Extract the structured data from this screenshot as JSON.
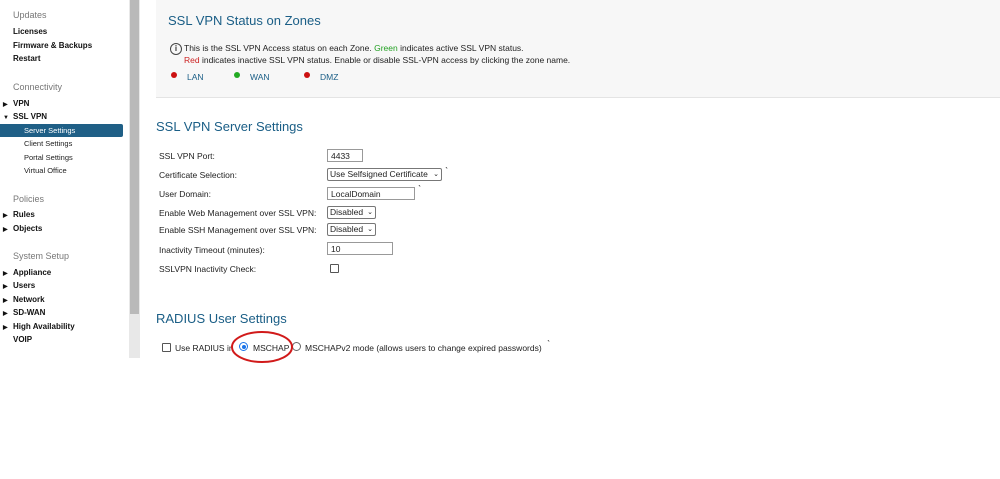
{
  "sidebar": {
    "updates_header": "Updates",
    "licenses": "Licenses",
    "firmware": "Firmware & Backups",
    "restart": "Restart",
    "connectivity_header": "Connectivity",
    "vpn": "VPN",
    "sslvpn": "SSL VPN",
    "sslvpn_items": [
      "Server Settings",
      "Client Settings",
      "Portal Settings",
      "Virtual Office"
    ],
    "policies_header": "Policies",
    "rules": "Rules",
    "objects": "Objects",
    "system_header": "System Setup",
    "system_items": [
      "Appliance",
      "Users",
      "Network",
      "SD-WAN",
      "High Availability"
    ],
    "voip": "VOIP"
  },
  "status": {
    "title": "SSL VPN Status on Zones",
    "line1_pre": "This is the SSL VPN Access status on each Zone. ",
    "line1_green": "Green",
    "line1_post": " indicates active SSL VPN status.",
    "line2_red": "Red",
    "line2_post": " indicates inactive SSL VPN status. Enable or disable SSL-VPN access by clicking the zone name.",
    "zones": [
      {
        "name": "LAN",
        "color": "#cc1111"
      },
      {
        "name": "WAN",
        "color": "#22aa22"
      },
      {
        "name": "DMZ",
        "color": "#cc1111"
      }
    ]
  },
  "server": {
    "title": "SSL VPN Server Settings",
    "port_label": "SSL VPN Port:",
    "port_value": "4433",
    "cert_label": "Certificate Selection:",
    "cert_value": "Use Selfsigned Certificate",
    "domain_label": "User Domain:",
    "domain_value": "LocalDomain",
    "web_mgmt_label": "Enable Web Management over SSL VPN:",
    "web_mgmt_value": "Disabled",
    "ssh_mgmt_label": "Enable SSH Management over SSL VPN:",
    "ssh_mgmt_value": "Disabled",
    "timeout_label": "Inactivity Timeout (minutes):",
    "timeout_value": "10",
    "inactivity_check_label": "SSLVPN Inactivity Check:"
  },
  "radius": {
    "title": "RADIUS User Settings",
    "use_radius_label": "Use RADIUS in",
    "mschap_label": "MSCHAP",
    "mschapv2_label": "MSCHAPv2 mode (allows users to change expired passwords)"
  },
  "colors": {
    "accent": "#1a5e86",
    "annotation": "#d11a1a"
  }
}
